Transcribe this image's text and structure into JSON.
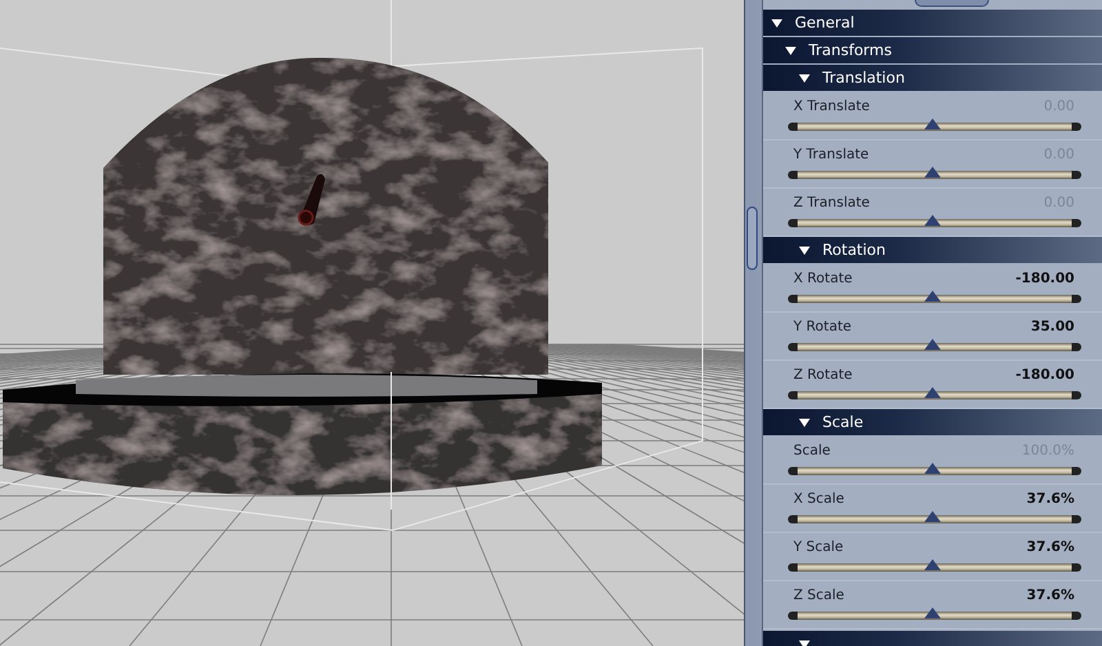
{
  "panel": {
    "general": {
      "title": "General",
      "expanded": true
    },
    "transforms": {
      "title": "Transforms",
      "expanded": true
    },
    "groups": [
      {
        "title": "Translation",
        "expanded": true,
        "params": [
          {
            "label": "X Translate",
            "value": "0.00",
            "modified": false,
            "level": 0.49
          },
          {
            "label": "Y Translate",
            "value": "0.00",
            "modified": false,
            "level": 0.49
          },
          {
            "label": "Z Translate",
            "value": "0.00",
            "modified": false,
            "level": 0.49
          }
        ]
      },
      {
        "title": "Rotation",
        "expanded": true,
        "params": [
          {
            "label": "X Rotate",
            "value": "-180.00",
            "modified": true,
            "level": 0.49
          },
          {
            "label": "Y Rotate",
            "value": "35.00",
            "modified": true,
            "level": 0.49
          },
          {
            "label": "Z Rotate",
            "value": "-180.00",
            "modified": true,
            "level": 0.49
          }
        ]
      },
      {
        "title": "Scale",
        "expanded": true,
        "params": [
          {
            "label": "Scale",
            "value": "100.0%",
            "modified": false,
            "level": 0.49
          },
          {
            "label": "X Scale",
            "value": "37.6%",
            "modified": true,
            "level": 0.49
          },
          {
            "label": "Y Scale",
            "value": "37.6%",
            "modified": true,
            "level": 0.49
          },
          {
            "label": "Z Scale",
            "value": "37.6%",
            "modified": true,
            "level": 0.49
          }
        ]
      }
    ],
    "misc": {
      "expanded": true
    }
  }
}
